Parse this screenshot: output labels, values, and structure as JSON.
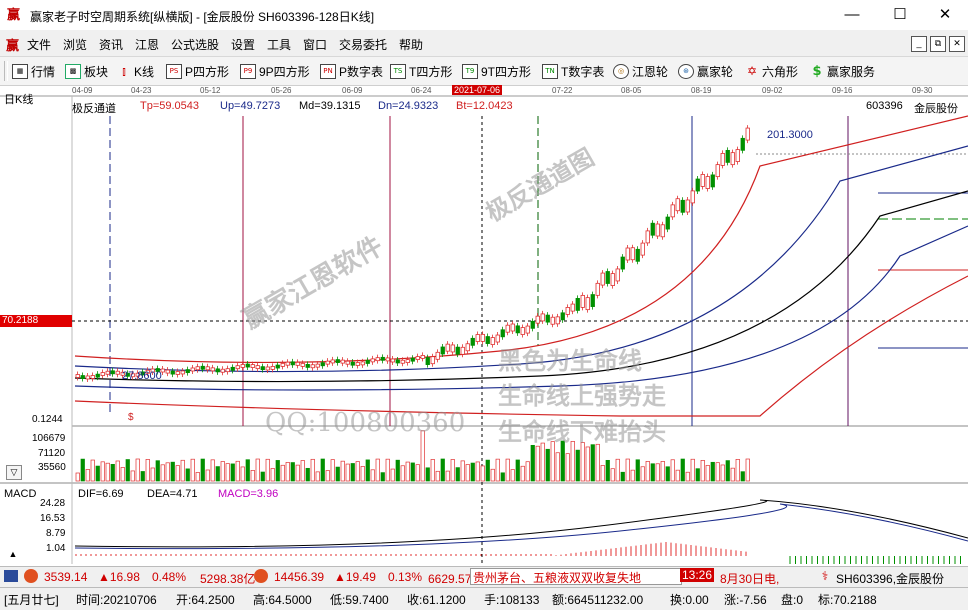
{
  "window": {
    "title": "赢家老子时空周期系统[纵横版] - [金辰股份  SH603396-128日K线]",
    "minimize": "—",
    "maximize": "☐",
    "close": "✕",
    "app_logo": "赢"
  },
  "menu": {
    "logo": "赢",
    "items": [
      "文件",
      "浏览",
      "资讯",
      "江恩",
      "公式选股",
      "设置",
      "工具",
      "窗口",
      "交易委托",
      "帮助"
    ],
    "mdi_buttons": [
      "_",
      "⧉",
      "✕"
    ]
  },
  "toolbar": {
    "items": [
      {
        "label": "行情",
        "icon": "grid-icon"
      },
      {
        "label": "板块",
        "icon": "blocks-icon"
      },
      {
        "label": "K线",
        "icon": "candlestick-icon"
      },
      {
        "label": "P四方形",
        "icon": "PS"
      },
      {
        "label": "9P四方形",
        "icon": "P9"
      },
      {
        "label": "P数字表",
        "icon": "PN"
      },
      {
        "label": "T四方形",
        "icon": "TS"
      },
      {
        "label": "9T四方形",
        "icon": "T9"
      },
      {
        "label": "T数字表",
        "icon": "TN"
      },
      {
        "label": "江恩轮",
        "icon": "gann-wheel-icon"
      },
      {
        "label": "赢家轮",
        "icon": "winner-wheel-icon"
      },
      {
        "label": "六角形",
        "icon": "hexagon-icon"
      },
      {
        "label": "赢家服务",
        "icon": "dollar-icon"
      }
    ]
  },
  "chart": {
    "period_label": "日K线",
    "date_ticks": [
      "04-09",
      "04-23",
      "05-12",
      "05-26",
      "06-09",
      "06-24",
      "2021-07-06",
      "07-22",
      "08-05",
      "08-19",
      "09-02",
      "09-16",
      "09-30"
    ],
    "indicator_name": "极反通道",
    "tp": "Tp=59.0543",
    "up": "Up=49.7273",
    "md": "Md=39.1315",
    "dn": "Dn=24.9323",
    "bt": "Bt=12.0423",
    "stock_code": "603396",
    "stock_name": "金辰股份",
    "price_high_label": "201.3000",
    "price_low_label": "27.8600",
    "crosshair_price": "70.2188",
    "axis_bottom_value": "0.1244",
    "dollar_mark": "$",
    "volume_ticks": [
      "106679",
      "71120",
      "35560"
    ],
    "volume_scroll": "▽",
    "watermark_1": "赢家江恩软件",
    "watermark_2": "极反通道图",
    "watermark_qq": "QQ:100800360",
    "slogan_1": "黑色为生命线",
    "slogan_2": "生命线上强势走",
    "slogan_3": "生命线下难抬头"
  },
  "macd": {
    "name": "MACD",
    "dif": "DIF=6.69",
    "dea": "DEA=4.71",
    "macd": "MACD=3.96",
    "ticks": [
      "24.28",
      "16.53",
      "8.79",
      "1.04"
    ],
    "scroll": "▲"
  },
  "status": {
    "sh_index": "3539.14",
    "sh_change": "▲16.98",
    "sh_pct": "0.48%",
    "sh_amount": "5298.38亿",
    "sz_index": "14456.39",
    "sz_change": "▲19.49",
    "sz_pct": "0.13%",
    "sz_amount": "6629.57亿",
    "news": "贵州茅台、五粮液双双收复失地",
    "time": "13:26",
    "news_2": "8月30日电,",
    "stock": "SH603396,金辰股份"
  },
  "quote": {
    "lunar": "[五月廿七]",
    "time": "时间:20210706",
    "open": "开:64.2500",
    "high": "高:64.5000",
    "low": "低:59.7400",
    "close": "收:61.1200",
    "volume": "手:108133",
    "amount": "额:664511232.00",
    "change_vol": "换:0.00",
    "change": "涨:-7.56",
    "pan": "盘:0",
    "mark": "标:70.2188"
  },
  "colors": {
    "up_candle": "#e03030",
    "down_candle": "#009000",
    "tp_line": "#d02020",
    "up_line": "#1a2a8a",
    "md_line": "#000000",
    "crosshair_label_bg": "#e00000"
  },
  "chart_data": {
    "type": "candlestick",
    "title": "极反通道",
    "series": [
      {
        "name": "Tp",
        "value_last": 59.0543
      },
      {
        "name": "Up",
        "value_last": 49.7273
      },
      {
        "name": "Md",
        "value_last": 39.1315
      },
      {
        "name": "Dn",
        "value_last": 24.9323
      },
      {
        "name": "Bt",
        "value_last": 12.0423
      }
    ],
    "price_high": 201.3,
    "price_low": 27.86
  }
}
